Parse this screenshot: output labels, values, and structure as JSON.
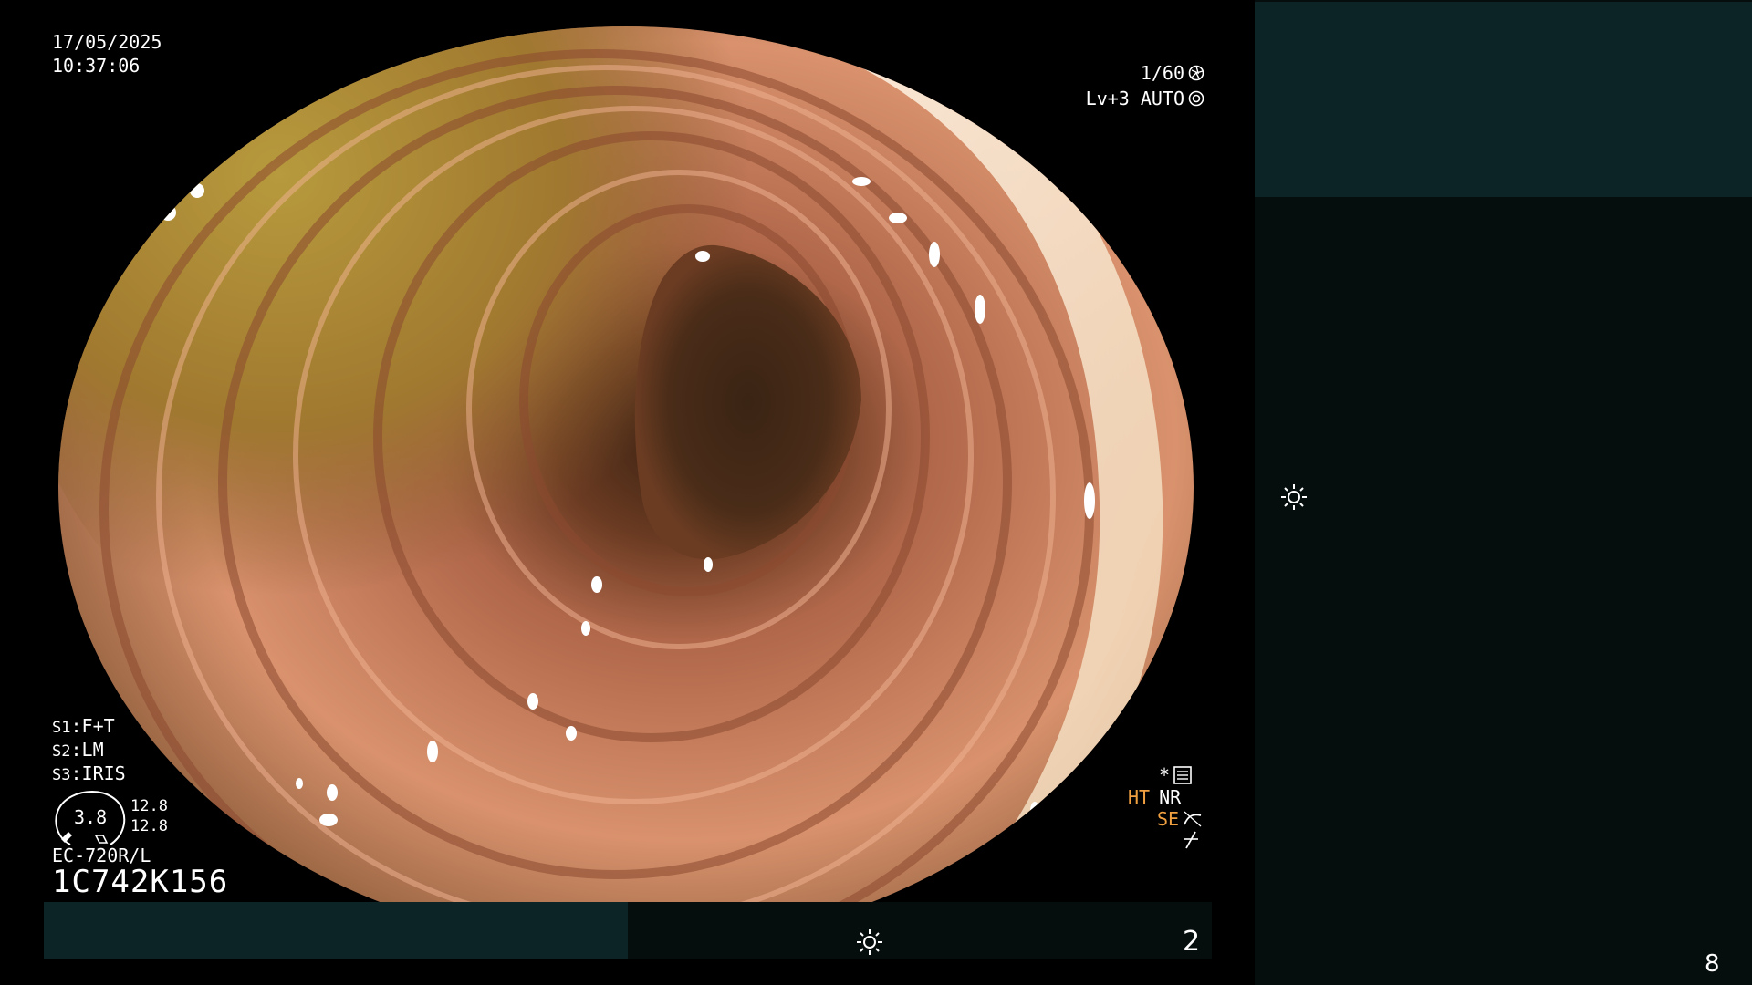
{
  "datetime": {
    "date": "17/05/2025",
    "time": "10:37:06"
  },
  "shutter": {
    "value": "1/60",
    "icon": "shutter-icon"
  },
  "level": {
    "value": "Lv+3",
    "mode": "AUTO",
    "icon": "iris-icon"
  },
  "switches": [
    {
      "prefix": "S1",
      "value": "F+T"
    },
    {
      "prefix": "S2",
      "value": "LM"
    },
    {
      "prefix": "S3",
      "value": "IRIS"
    }
  ],
  "gauge": {
    "center": "3.8",
    "top_right": "12.8",
    "bottom_right": "12.8"
  },
  "scope": {
    "model": "EC-720R/L",
    "serial": "1C742K156"
  },
  "enhancement": {
    "asterisk": "*",
    "ht": "HT",
    "nr": "NR",
    "se": "SE",
    "icons": [
      "settings-card-icon",
      "curve-icon",
      "slope-icon"
    ]
  },
  "bottom_bar": {
    "sun_icon": "brightness-icon",
    "number": "2"
  },
  "right_panel": {
    "sun_icon": "brightness-icon",
    "number": "8"
  },
  "colors": {
    "panel_accent": "#0c2425",
    "panel_dark": "#050e0d",
    "orange_text": "#f0a040"
  }
}
